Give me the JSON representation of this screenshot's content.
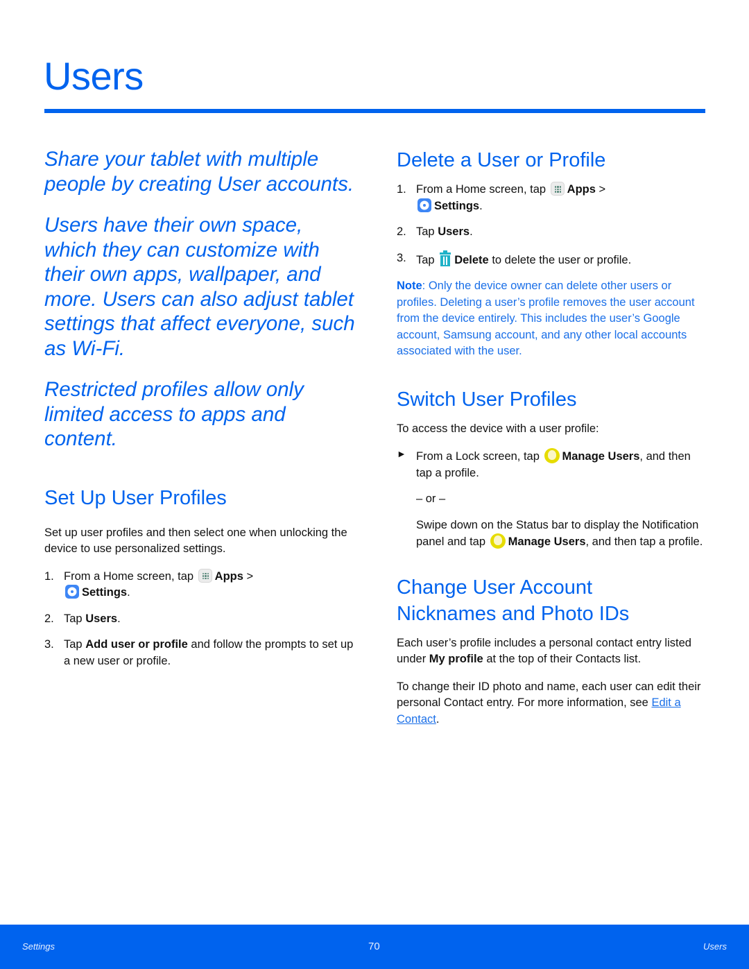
{
  "page": {
    "title": "Users",
    "accent_color": "#0063ee"
  },
  "left": {
    "intro": [
      "Share your tablet with multiple people by creating User accounts.",
      "Users have their own space, which they can customize with their own apps, wallpaper, and more. Users can also adjust tablet settings that affect everyone, such as Wi-Fi.",
      "Restricted profiles allow only limited access to apps and content."
    ],
    "setup": {
      "heading": "Set Up User Profiles",
      "body": "Set up user profiles and then select one when unlocking the device to use personalized settings.",
      "steps": [
        {
          "num": "1.",
          "pre": "From a Home screen, tap",
          "apps": "Apps",
          "sep": ">",
          "settings": "Settings",
          "end": "."
        },
        {
          "num": "2.",
          "pre": "Tap",
          "bold": "Users",
          "end": "."
        },
        {
          "num": "3.",
          "pre": "Tap",
          "bold": "Add user or profile",
          "end": "and follow the prompts to set up a new user or profile."
        }
      ]
    }
  },
  "right": {
    "delete": {
      "heading": "Delete a User or Profile",
      "steps": [
        {
          "num": "1.",
          "pre": "From a Home screen, tap",
          "apps": "Apps",
          "sep": ">",
          "settings": "Settings",
          "end": "."
        },
        {
          "num": "2.",
          "pre": "Tap",
          "bold": "Users",
          "end": "."
        },
        {
          "num": "3.",
          "pre": "Tap",
          "bold": "Delete",
          "end": "to delete the user or profile."
        }
      ],
      "note_label": "Note",
      "note_text": ": Only the device owner can delete other users or profiles. Deleting a user’s profile removes the user account from the device entirely. This includes the user’s Google account, Samsung account, and any other local accounts associated with the user."
    },
    "switch": {
      "heading": "Switch User Profiles",
      "intro": "To access the device with a user profile:",
      "bullet_pre": "From a Lock screen, tap",
      "bullet_bold": "Manage Users",
      "bullet_end": ", and then tap a profile.",
      "or": "– or –",
      "alt_pre": "Swipe down on the Status bar to display the Notification panel and tap",
      "alt_bold": "Manage Users",
      "alt_end": ", and then tap a profile."
    },
    "change": {
      "heading": "Change User Account Nicknames and Photo IDs",
      "p1_pre": "Each user’s profile includes a personal contact entry listed under",
      "p1_bold": "My profile",
      "p1_end": "at the top of their Contacts list.",
      "p2_pre": "To change their ID photo and name, each user can edit their personal Contact entry. For more information, see",
      "p2_link": "Edit a Contact",
      "p2_end": "."
    }
  },
  "footer": {
    "left": "Settings",
    "page_number": "70",
    "right": "Users"
  }
}
